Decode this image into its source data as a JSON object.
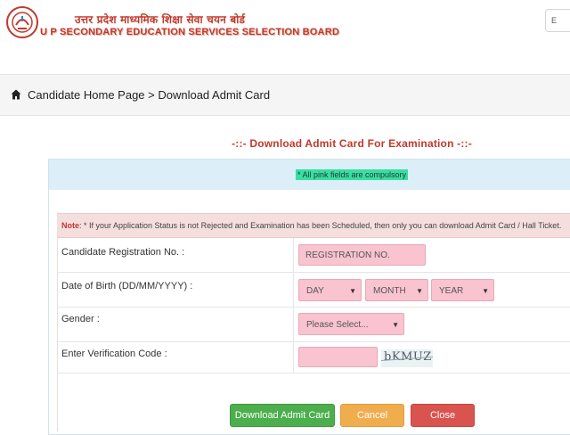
{
  "header": {
    "hindi_title": "उत्तर प्रदेश माध्यमिक शिक्षा सेवा चयन बोर्ड",
    "english_title": "U P SECONDARY EDUCATION SERVICES SELECTION BOARD",
    "top_right_label": "E",
    "logo_icon": "up-govt-emblem-icon"
  },
  "breadcrumb": {
    "text": "Candidate Home Page > Download Admit Card",
    "icon": "home-icon"
  },
  "page_heading": "-::- Download Admit Card For Examination -::-",
  "compulsory_note": "* All pink fields are compulsory",
  "note": {
    "label": "Note",
    "text": ": * If your Application Status is not Rejected and Examination has been Scheduled, then only you can download Admit Card / Hall Ticket."
  },
  "form": {
    "registration_label": "Candidate Registration No. :",
    "registration_placeholder": "REGISTRATION NO.",
    "dob_label": "Date of Birth (DD/MM/YYYY) :",
    "day_option": "DAY",
    "month_option": "MONTH",
    "year_option": "YEAR",
    "gender_label": "Gender :",
    "gender_option": "Please Select...",
    "verification_label": "Enter Verification Code :",
    "verification_value": "",
    "captcha_text": "bKMUZ"
  },
  "buttons": {
    "download": "Download Admit Card",
    "cancel": "Cancel",
    "close": "Close"
  },
  "colors": {
    "brand_red": "#c0392b",
    "pink_field": "#f9c3d0",
    "green_button": "#4cae4c",
    "orange_button": "#f0ad4e",
    "red_button": "#d9534f"
  }
}
